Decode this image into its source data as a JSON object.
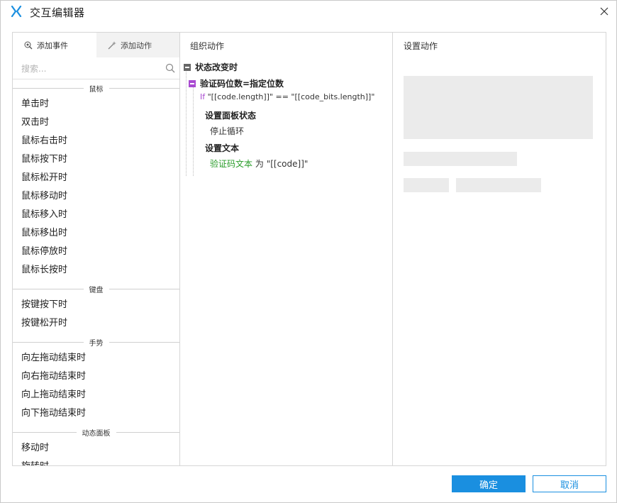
{
  "window": {
    "title": "交互编辑器",
    "accent_color": "#1a8fe0",
    "logo_icon": "axure-x-logo",
    "close_icon": "close-icon"
  },
  "left_panel": {
    "tabs": [
      {
        "label": "添加事件",
        "icon": "add-event-icon",
        "active": true
      },
      {
        "label": "添加动作",
        "icon": "add-action-icon",
        "active": false
      }
    ],
    "search": {
      "placeholder": "搜索...",
      "value": ""
    },
    "sections": [
      {
        "header": "鼠标",
        "items": [
          "单击时",
          "双击时",
          "鼠标右击时",
          "鼠标按下时",
          "鼠标松开时",
          "鼠标移动时",
          "鼠标移入时",
          "鼠标移出时",
          "鼠标停放时",
          "鼠标长按时"
        ]
      },
      {
        "header": "键盘",
        "items": [
          "按键按下时",
          "按键松开时"
        ]
      },
      {
        "header": "手势",
        "items": [
          "向左拖动结束时",
          "向右拖动结束时",
          "向上拖动结束时",
          "向下拖动结束时"
        ]
      },
      {
        "header": "动态面板",
        "items": [
          "移动时",
          "旋转时"
        ]
      }
    ]
  },
  "middle_panel": {
    "title": "组织动作",
    "event": "状态改变时",
    "case": "验证码位数=指定位数",
    "condition": {
      "keyword": "If",
      "expression": "\"[[code.length]]\" == \"[[code_bits.length]]\""
    },
    "actions": [
      {
        "title": "设置面板状态",
        "detail": "停止循环"
      },
      {
        "title": "设置文本",
        "target": "验证码文本",
        "connector": "为",
        "value": "\"[[code]]\""
      }
    ]
  },
  "right_panel": {
    "title": "设置动作"
  },
  "buttons": {
    "ok": "确定",
    "cancel": "取消"
  }
}
